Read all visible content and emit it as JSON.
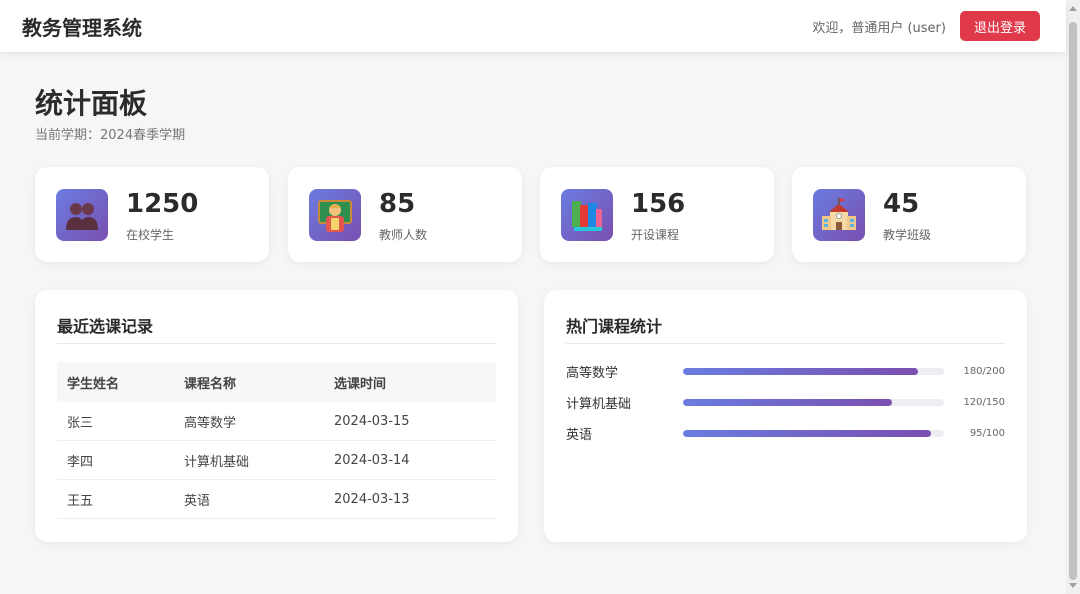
{
  "header": {
    "app_title": "教务管理系统",
    "welcome": "欢迎，普通用户 (user)",
    "logout_label": "退出登录"
  },
  "page": {
    "title": "统计面板",
    "semester": "当前学期：2024春季学期"
  },
  "stats": [
    {
      "value": "1250",
      "label": "在校学生",
      "icon": "students-icon"
    },
    {
      "value": "85",
      "label": "教师人数",
      "icon": "teacher-icon"
    },
    {
      "value": "156",
      "label": "开设课程",
      "icon": "books-icon"
    },
    {
      "value": "45",
      "label": "教学班级",
      "icon": "school-icon"
    }
  ],
  "recent": {
    "title": "最近选课记录",
    "columns": [
      "学生姓名",
      "课程名称",
      "选课时间"
    ],
    "rows": [
      [
        "张三",
        "高等数学",
        "2024-03-15"
      ],
      [
        "李四",
        "计算机基础",
        "2024-03-14"
      ],
      [
        "王五",
        "英语",
        "2024-03-13"
      ]
    ]
  },
  "popular": {
    "title": "热门课程统计",
    "courses": [
      {
        "name": "高等数学",
        "count": "180/200",
        "fill": 0.9
      },
      {
        "name": "计算机基础",
        "count": "120/150",
        "fill": 0.8
      },
      {
        "name": "英语",
        "count": "95/100",
        "fill": 0.95
      }
    ]
  },
  "colors": {
    "accent_start": "#6a7de0",
    "accent_end": "#7a4fb0",
    "danger": "#e0394a"
  }
}
